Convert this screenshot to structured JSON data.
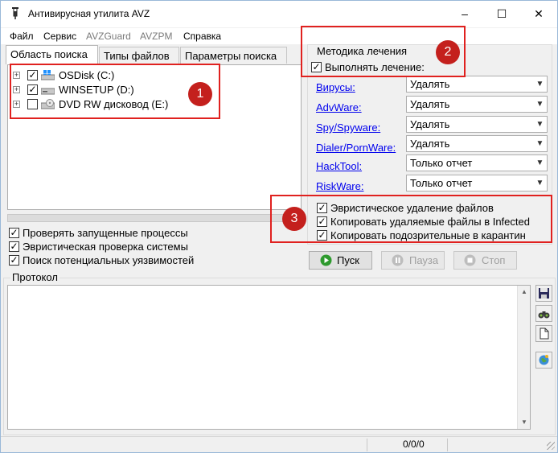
{
  "window": {
    "title": "Антивирусная утилита AVZ",
    "controls": {
      "minimize": "–",
      "maximize": "☐",
      "close": "✕"
    }
  },
  "menu": [
    {
      "label": "Файл",
      "enabled": true
    },
    {
      "label": "Сервис",
      "enabled": true
    },
    {
      "label": "AVZGuard",
      "enabled": false
    },
    {
      "label": "AVZPM",
      "enabled": false
    },
    {
      "label": "Справка",
      "enabled": true
    }
  ],
  "tabs": [
    {
      "label": "Область поиска",
      "active": true
    },
    {
      "label": "Типы файлов",
      "active": false
    },
    {
      "label": "Параметры поиска",
      "active": false
    }
  ],
  "drives": [
    {
      "label": "OSDisk (C:)",
      "checked": true,
      "icon": "windows-drive-icon"
    },
    {
      "label": "WINSETUP (D:)",
      "checked": true,
      "icon": "hard-drive-icon"
    },
    {
      "label": "DVD RW дисковод (E:)",
      "checked": false,
      "icon": "dvd-drive-icon"
    }
  ],
  "scan_options": [
    {
      "label": "Проверять запущенные процессы",
      "checked": true
    },
    {
      "label": "Эвристическая проверка системы",
      "checked": true
    },
    {
      "label": "Поиск потенциальных уязвимостей",
      "checked": true
    }
  ],
  "treatment": {
    "group_title": "Методика лечения",
    "perform_label": "Выполнять лечение:",
    "perform_checked": true,
    "rows": [
      {
        "label": "Вирусы:",
        "value": "Удалять"
      },
      {
        "label": "AdvWare:",
        "value": "Удалять"
      },
      {
        "label": "Spy/Spyware:",
        "value": "Удалять"
      },
      {
        "label": "Dialer/PornWare:",
        "value": "Удалять"
      },
      {
        "label": "HackTool:",
        "value": "Только отчет"
      },
      {
        "label": "RiskWare:",
        "value": "Только отчет"
      }
    ]
  },
  "heuristic_options": [
    {
      "label": "Эвристическое удаление файлов",
      "checked": true
    },
    {
      "label": "Копировать удаляемые файлы в  Infected",
      "checked": true
    },
    {
      "label": "Копировать подозрительные в  карантин",
      "checked": true
    }
  ],
  "buttons": {
    "start": "Пуск",
    "pause": "Пауза",
    "stop": "Стоп"
  },
  "protocol": {
    "title": "Протокол"
  },
  "status": {
    "counter": "0/0/0"
  },
  "annotations": [
    "1",
    "2",
    "3"
  ],
  "colors": {
    "highlight": "#e0211f",
    "badge": "#c4201d",
    "link": "#0000ee",
    "start_icon": "#2e9a2e"
  }
}
